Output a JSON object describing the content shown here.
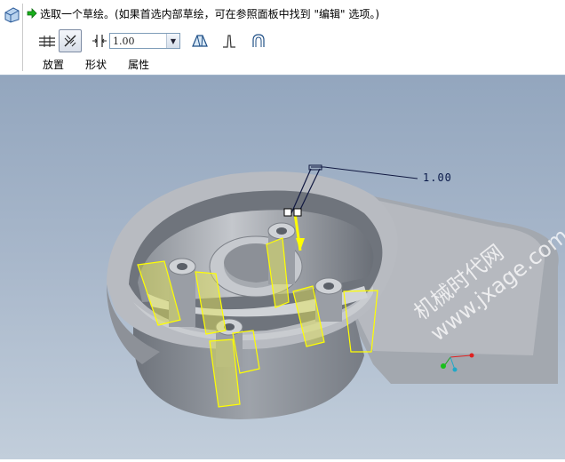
{
  "dashboard": {
    "message": "选取一个草绘。(如果首选内部草绘，可在参照面板中找到 \"编辑\" 选项。)",
    "depth_value": "1.00",
    "tabs": [
      "放置",
      "形状",
      "属性"
    ]
  },
  "viewport": {
    "dimension_label": "1.00",
    "watermark_line1": "机械时代网",
    "watermark_line2": "www.jxage.com"
  },
  "colors": {
    "background": "#a5b4c7",
    "part": "#b4b7bd",
    "highlight": "#ffff00",
    "accent_green": "#19a11b"
  },
  "icons": [
    "rib-feature-icon",
    "next-arrow-icon",
    "symmetric-icon",
    "flip-direction-icon",
    "thickness-icon",
    "dropdown-icon",
    "taper-icon",
    "straight-edge-icon",
    "rounded-edge-icon"
  ]
}
